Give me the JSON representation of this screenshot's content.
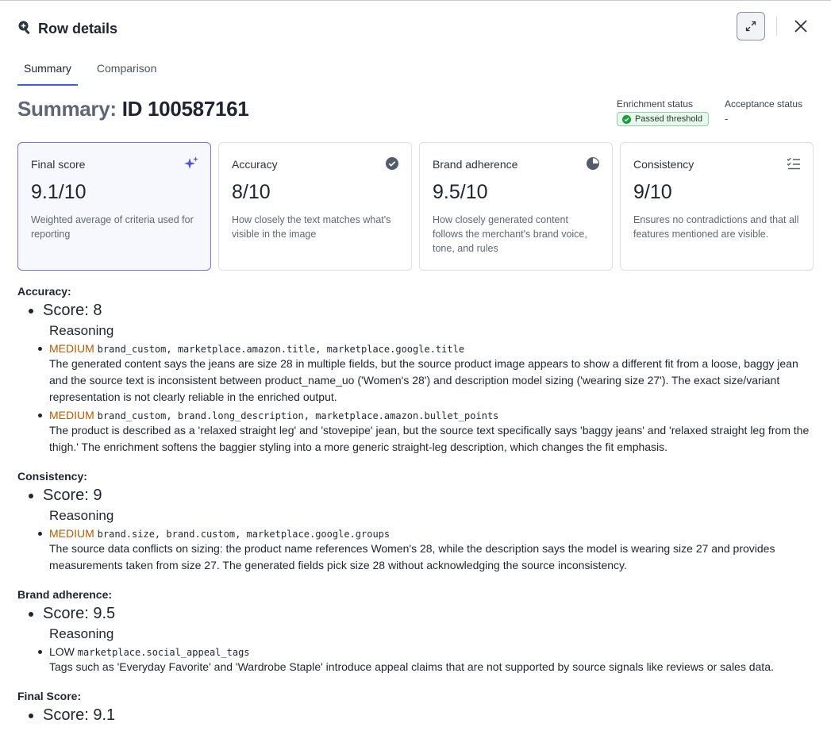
{
  "header": {
    "title": "Row details",
    "icon": "magnifier-plus-icon"
  },
  "tabs": [
    {
      "label": "Summary",
      "active": true
    },
    {
      "label": "Comparison",
      "active": false
    }
  ],
  "summary": {
    "title_prefix": "Summary:",
    "title_id": "ID 100587161",
    "enrichment_status_label": "Enrichment status",
    "enrichment_status_badge": "Passed threshold",
    "acceptance_status_label": "Acceptance status",
    "acceptance_status_value": "-"
  },
  "cards": [
    {
      "label": "Final score",
      "value": "9.1/10",
      "desc": "Weighted average of criteria used for reporting",
      "icon": "sparkles-icon"
    },
    {
      "label": "Accuracy",
      "value": "8/10",
      "desc": "How closely the text matches what's visible in the image",
      "icon": "check-badge-icon"
    },
    {
      "label": "Brand adherence",
      "value": "9.5/10",
      "desc": "How closely generated content follows the merchant's brand voice, tone, and rules",
      "icon": "pie-chart-icon"
    },
    {
      "label": "Consistency",
      "value": "9/10",
      "desc": "Ensures no contradictions and that all features mentioned are visible.",
      "icon": "checklist-icon"
    }
  ],
  "sections": {
    "accuracy": {
      "title": "Accuracy:",
      "score": "Score: 8",
      "reasoning": "Reasoning",
      "issues": [
        {
          "severity": "MEDIUM",
          "fields": "brand_custom, marketplace.amazon.title, marketplace.google.title",
          "text": "The generated content says the jeans are size 28 in multiple fields, but the source product image appears to show a different fit from a loose, baggy jean and the source text is inconsistent between product_name_uo ('Women's 28') and description model sizing ('wearing size 27'). The exact size/variant representation is not clearly reliable in the enriched output."
        },
        {
          "severity": "MEDIUM",
          "fields": "brand_custom, brand.long_description, marketplace.amazon.bullet_points",
          "text": "The product is described as a 'relaxed straight leg' and 'stovepipe' jean, but the source text specifically says 'baggy jeans' and 'relaxed straight leg from the thigh.' The enrichment softens the baggier styling into a more generic straight-leg description, which changes the fit emphasis."
        }
      ]
    },
    "consistency": {
      "title": "Consistency:",
      "score": "Score: 9",
      "reasoning": "Reasoning",
      "issues": [
        {
          "severity": "MEDIUM",
          "fields": "brand.size, brand.custom, marketplace.google.groups",
          "text": "The source data conflicts on sizing: the product name references Women's 28, while the description says the model is wearing size 27 and provides measurements taken from size 27. The generated fields pick size 28 without acknowledging the source inconsistency."
        }
      ]
    },
    "brand": {
      "title": "Brand adherence:",
      "score": "Score: 9.5",
      "reasoning": "Reasoning",
      "issues": [
        {
          "severity": "LOW",
          "fields": "marketplace.social_appeal_tags",
          "text": "Tags such as 'Everyday Favorite' and 'Wardrobe Staple' introduce appeal claims that are not supported by source signals like reviews or sales data."
        }
      ]
    },
    "final": {
      "title": "Final Score:",
      "score": "Score: 9.1"
    }
  },
  "colors": {
    "accent": "#3b5bdb",
    "medium": "#b35c00",
    "success": "#1a9c3c",
    "active_card_border": "#7c6ef0"
  }
}
